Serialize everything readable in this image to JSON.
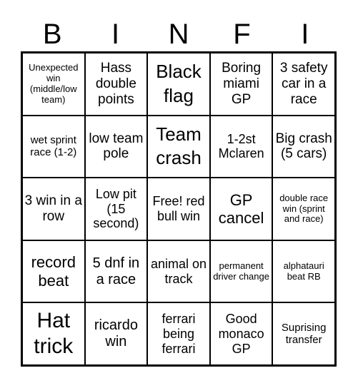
{
  "header": [
    "B",
    "I",
    "N",
    "F",
    "I"
  ],
  "cells": [
    "Unexpected win (middle/low team)",
    "Hass double points",
    "Black flag",
    "Boring miami GP",
    "3 safety car in a race",
    "wet sprint race (1-2)",
    "low team pole",
    "Team crash",
    "1-2st Mclaren",
    "Big crash (5 cars)",
    "3 win in a row",
    "Low pit (15 second)",
    "Free! red bull win",
    "GP cancel",
    "double race win (sprint and race)",
    "record beat",
    "5 dnf in a race",
    "animal on track",
    "permanent driver change",
    "alphatauri beat RB",
    "Hat trick",
    "ricardo win",
    "ferrari being ferrari",
    "Good monaco GP",
    "Suprising transfer"
  ]
}
